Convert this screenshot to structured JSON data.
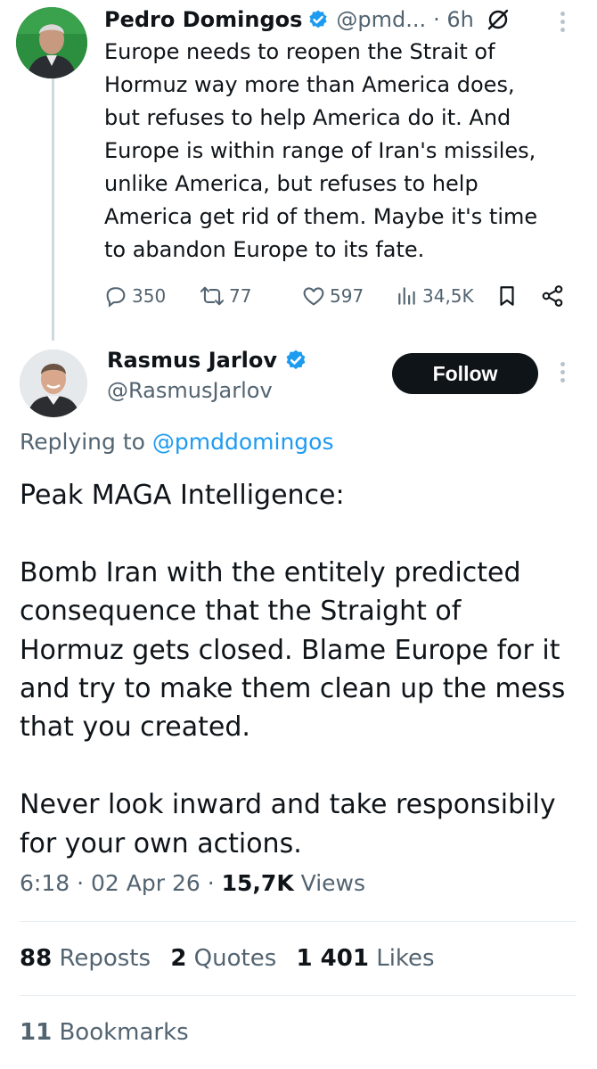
{
  "parent_tweet": {
    "author_name": "Pedro Domingos",
    "handle": "@pmd...",
    "time": "· 6h",
    "text": "Europe needs to reopen the Strait of\nHormuz way more than America does,\nbut refuses to help America do it. And\nEurope is within range of Iran's missiles,\nunlike America, but refuses to help\nAmerica get rid of them. Maybe it's time\nto abandon Europe to its fate.",
    "replies": "350",
    "reposts": "77",
    "likes": "597",
    "views": "34,5K",
    "icons": [
      "verified-badge-icon",
      "grok-icon",
      "more-icon",
      "reply-icon",
      "repost-icon",
      "like-icon",
      "views-icon",
      "bookmark-icon",
      "share-icon"
    ]
  },
  "main_tweet": {
    "author_name": "Rasmus Jarlov",
    "handle": "@RasmusJarlov",
    "follow_label": "Follow",
    "replying_prefix": "Replying to ",
    "replying_handle": "@pmddomingos",
    "text": "Peak MAGA Intelligence:\n\nBomb Iran with the entitely predicted\nconsequence that the Straight of\nHormuz gets closed. Blame Europe for it\nand try to make them clean up the mess\nthat you created.\n\nNever look inward and take responsibily\nfor your own actions.",
    "time": "6:18",
    "date": "02 Apr 26",
    "views_count": "15,7K",
    "views_label": "Views",
    "sep": "·",
    "reposts_count": "88",
    "reposts_label": "Reposts",
    "quotes_count": "2",
    "quotes_label": "Quotes",
    "likes_count": "1 401",
    "likes_label": "Likes",
    "bookmarks_count": "11",
    "bookmarks_label": "Bookmarks"
  },
  "colors": {
    "accent": "#1d9bf0",
    "text": "#0f1419",
    "muted": "#536471",
    "follow_bg": "#0f1419"
  }
}
